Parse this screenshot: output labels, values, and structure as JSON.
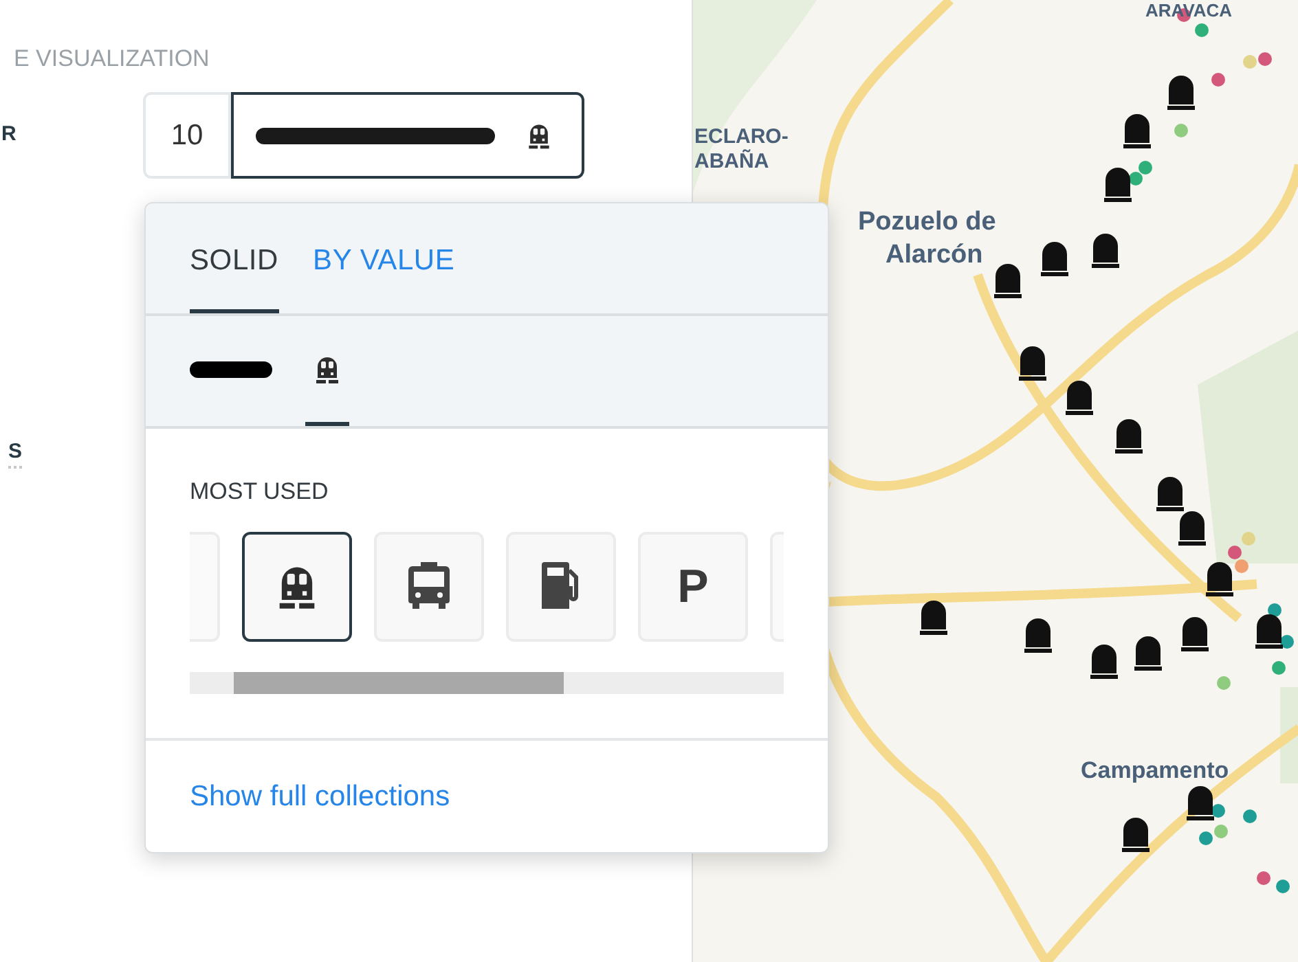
{
  "panel": {
    "section_title": "E VISUALIZATION",
    "row_label": "R",
    "row_label_2": "S",
    "size_value": "10"
  },
  "popover": {
    "tabs": [
      {
        "label": "SOLID",
        "selected": true
      },
      {
        "label": "BY VALUE",
        "selected": false
      }
    ],
    "style_options": [
      {
        "kind": "line",
        "selected": false
      },
      {
        "kind": "icon",
        "selected": true
      }
    ],
    "section_label": "MOST USED",
    "icons": [
      {
        "kind": "blank",
        "selected": false
      },
      {
        "kind": "train",
        "selected": true
      },
      {
        "kind": "bus",
        "selected": false
      },
      {
        "kind": "fuel",
        "selected": false
      },
      {
        "kind": "parking",
        "label": "P",
        "selected": false
      },
      {
        "kind": "blank",
        "selected": false
      }
    ],
    "link": "Show full collections"
  },
  "map": {
    "labels": [
      "ARAVACA",
      "ECLARO-",
      "ABAÑA",
      "Pozuelo de",
      "Alarcón",
      "Campamento"
    ]
  }
}
